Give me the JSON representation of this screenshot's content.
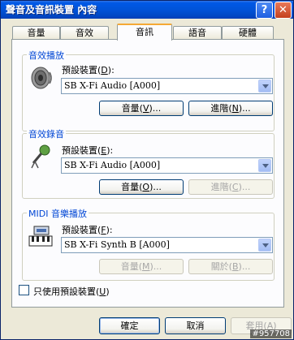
{
  "window": {
    "title": "聲音及音訊裝置 內容",
    "help_glyph": "?",
    "close_glyph": "✕"
  },
  "tabs": [
    {
      "label": "音量"
    },
    {
      "label": "音效"
    },
    {
      "label": "音訊",
      "active": true
    },
    {
      "label": "語音"
    },
    {
      "label": "硬體"
    }
  ],
  "groups": {
    "playback": {
      "title": "音效播放",
      "device_label": "預設裝置(",
      "device_key": "D",
      "device_value": "SB X-Fi Audio [A000]",
      "volume_btn": "音量(",
      "volume_key": "V",
      "advanced_btn": "進階(",
      "advanced_key": "N",
      "icon": "speaker-icon"
    },
    "recording": {
      "title": "音效錄音",
      "device_label": "預設裝置(",
      "device_key": "E",
      "device_value": "SB X-Fi Audio [A000]",
      "volume_btn": "音量(",
      "volume_key": "O",
      "advanced_btn": "進階(",
      "advanced_key": "C",
      "icon": "microphone-icon"
    },
    "midi": {
      "title": "MIDI 音樂播放",
      "device_label": "預設裝置(",
      "device_key": "F",
      "device_value": "SB X-Fi Synth B [A000]",
      "volume_btn": "音量(",
      "volume_key": "M",
      "about_btn": "關於(",
      "about_key": "B",
      "icon": "midi-keyboard-icon"
    }
  },
  "suffix_paren": ")",
  "suffix_colon": "):",
  "suffix_dots": ")...",
  "checkbox": {
    "label": "只使用預設裝置(",
    "key": "U",
    "checked": false
  },
  "buttons": {
    "ok": "確定",
    "cancel": "取消",
    "apply": "套用(",
    "apply_key": "A"
  },
  "watermark": "#957708",
  "colors": {
    "accent": "#0046d5",
    "tab_highlight": "#f5a935",
    "titlebar": "#0053d8"
  }
}
